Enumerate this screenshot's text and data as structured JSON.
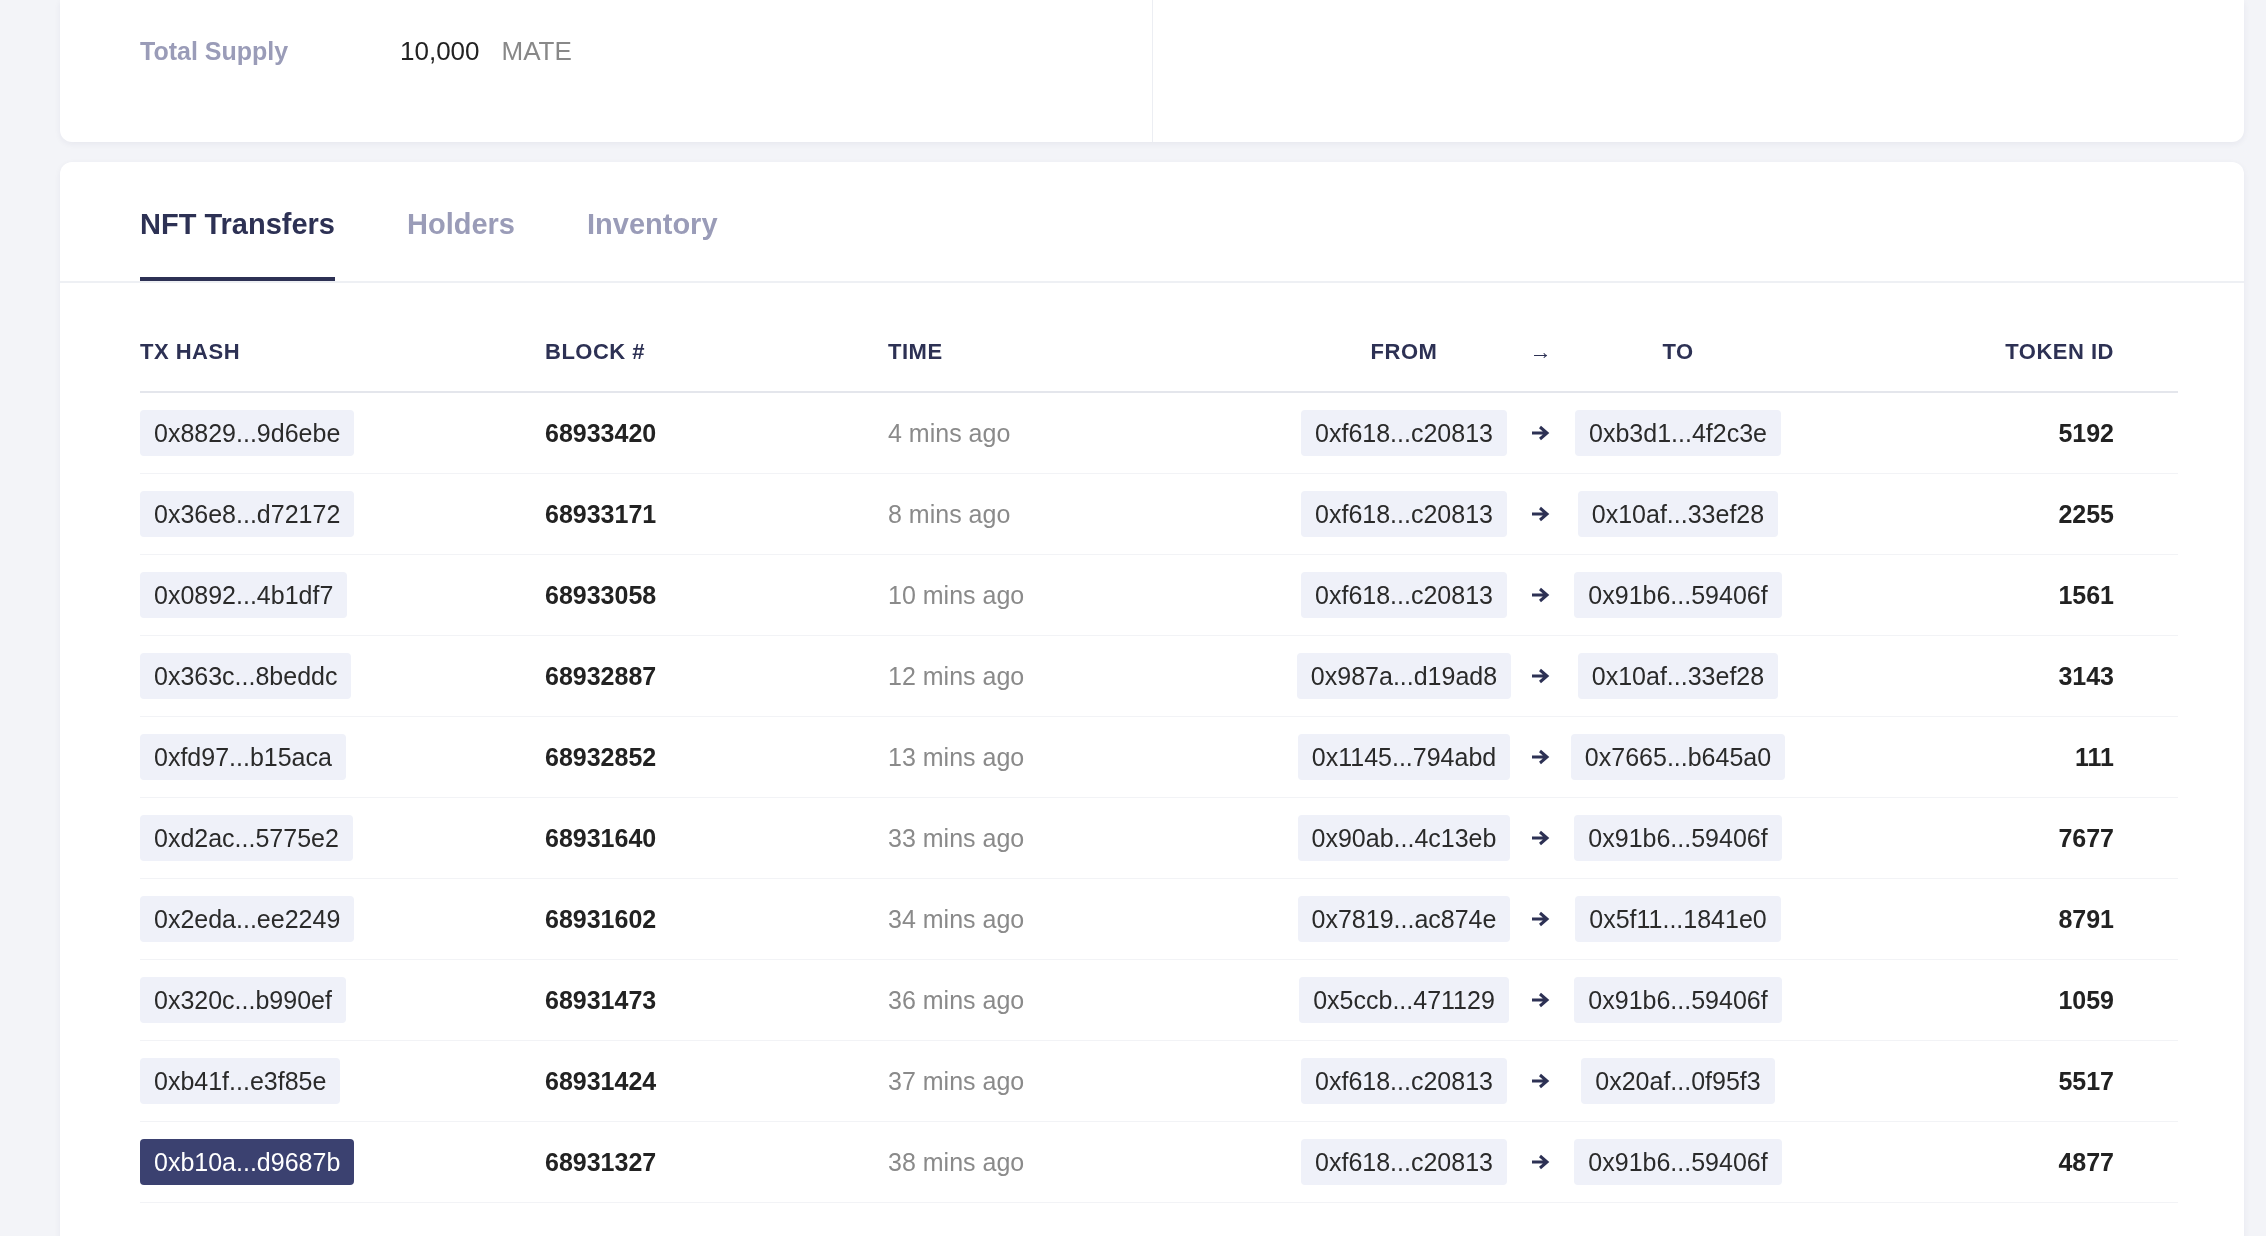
{
  "overview": {
    "label": "Total Supply",
    "value": "10,000",
    "unit": "MATE"
  },
  "tabs": [
    {
      "label": "NFT Transfers",
      "selected": true
    },
    {
      "label": "Holders",
      "selected": false
    },
    {
      "label": "Inventory",
      "selected": false
    }
  ],
  "table": {
    "columns": [
      "TX HASH",
      "BLOCK #",
      "TIME",
      "FROM",
      "→",
      "TO",
      "TOKEN ID"
    ],
    "rows": [
      {
        "tx_hash": "0x8829...9d6ebe",
        "selected": false,
        "block": "68933420",
        "time": "4 mins ago",
        "from": "0xf618...c20813",
        "to": "0xb3d1...4f2c3e",
        "token_id": "5192"
      },
      {
        "tx_hash": "0x36e8...d72172",
        "selected": false,
        "block": "68933171",
        "time": "8 mins ago",
        "from": "0xf618...c20813",
        "to": "0x10af...33ef28",
        "token_id": "2255"
      },
      {
        "tx_hash": "0x0892...4b1df7",
        "selected": false,
        "block": "68933058",
        "time": "10 mins ago",
        "from": "0xf618...c20813",
        "to": "0x91b6...59406f",
        "token_id": "1561"
      },
      {
        "tx_hash": "0x363c...8beddc",
        "selected": false,
        "block": "68932887",
        "time": "12 mins ago",
        "from": "0x987a...d19ad8",
        "to": "0x10af...33ef28",
        "token_id": "3143"
      },
      {
        "tx_hash": "0xfd97...b15aca",
        "selected": false,
        "block": "68932852",
        "time": "13 mins ago",
        "from": "0x1145...794abd",
        "to": "0x7665...b645a0",
        "token_id": "111"
      },
      {
        "tx_hash": "0xd2ac...5775e2",
        "selected": false,
        "block": "68931640",
        "time": "33 mins ago",
        "from": "0x90ab...4c13eb",
        "to": "0x91b6...59406f",
        "token_id": "7677"
      },
      {
        "tx_hash": "0x2eda...ee2249",
        "selected": false,
        "block": "68931602",
        "time": "34 mins ago",
        "from": "0x7819...ac874e",
        "to": "0x5f11...1841e0",
        "token_id": "8791"
      },
      {
        "tx_hash": "0x320c...b990ef",
        "selected": false,
        "block": "68931473",
        "time": "36 mins ago",
        "from": "0x5ccb...471129",
        "to": "0x91b6...59406f",
        "token_id": "1059"
      },
      {
        "tx_hash": "0xb41f...e3f85e",
        "selected": false,
        "block": "68931424",
        "time": "37 mins ago",
        "from": "0xf618...c20813",
        "to": "0x20af...0f95f3",
        "token_id": "5517"
      },
      {
        "tx_hash": "0xb10a...d9687b",
        "selected": true,
        "block": "68931327",
        "time": "38 mins ago",
        "from": "0xf618...c20813",
        "to": "0x91b6...59406f",
        "token_id": "4877"
      }
    ]
  }
}
